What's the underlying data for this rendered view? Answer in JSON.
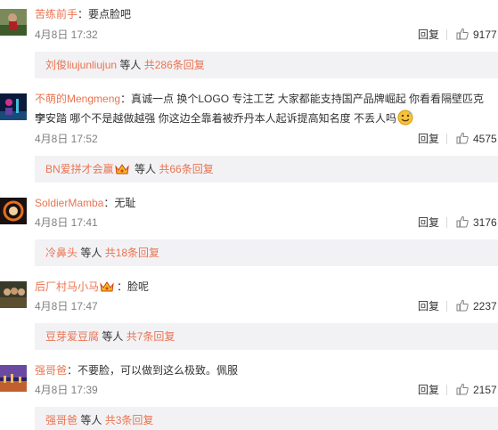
{
  "comments": [
    {
      "username": "苦练前手",
      "content": "：要点脸吧",
      "content_line2": "",
      "time": "4月8日 17:32",
      "reply_label": "回复",
      "likes": "9177",
      "replies": {
        "user": "刘俊liujunliujun",
        "middle": " 等人 ",
        "count": "共286条回复"
      }
    },
    {
      "username": "不萌的Mengmeng",
      "content": "：真诚一点 换个LOGO 专注工艺 大家都能支持国产品牌崛起 你看看隔壁匹克李",
      "content_line2": "宁安踏 哪个不是越做越强 你这边全靠着被乔丹本人起诉提高知名度 不丢人吗",
      "time": "4月8日 17:52",
      "reply_label": "回复",
      "likes": "4575",
      "replies": {
        "user": "BN爱拼才会赢",
        "middle": " 等人 ",
        "count": "共66条回复"
      }
    },
    {
      "username": "SoldierMamba",
      "content": "：无耻",
      "content_line2": "",
      "time": "4月8日 17:41",
      "reply_label": "回复",
      "likes": "3176",
      "replies": {
        "user": "冷鼻头",
        "middle": " 等人 ",
        "count": "共18条回复"
      }
    },
    {
      "username": "后厂村马小马",
      "content": "：脸呢",
      "content_line2": "",
      "time": "4月8日 17:47",
      "reply_label": "回复",
      "likes": "2237",
      "replies": {
        "user": "豆芽爱豆腐",
        "middle": " 等人 ",
        "count": "共7条回复"
      }
    },
    {
      "username": "强哥爸",
      "content": "：不要脸，可以做到这么极致。佩服",
      "content_line2": "",
      "time": "4月8日 17:39",
      "reply_label": "回复",
      "likes": "2157",
      "replies": {
        "user": "强哥爸",
        "middle": " 等人 ",
        "count": "共3条回复"
      }
    }
  ],
  "colors": {
    "username": "#eb7350",
    "text": "#333333",
    "meta": "#808080",
    "reply_bg": "#f2f2f5"
  },
  "icons": [
    "avatar",
    "thumbs-up-icon",
    "crown-badge-icon",
    "smiley-emoji-icon"
  ]
}
